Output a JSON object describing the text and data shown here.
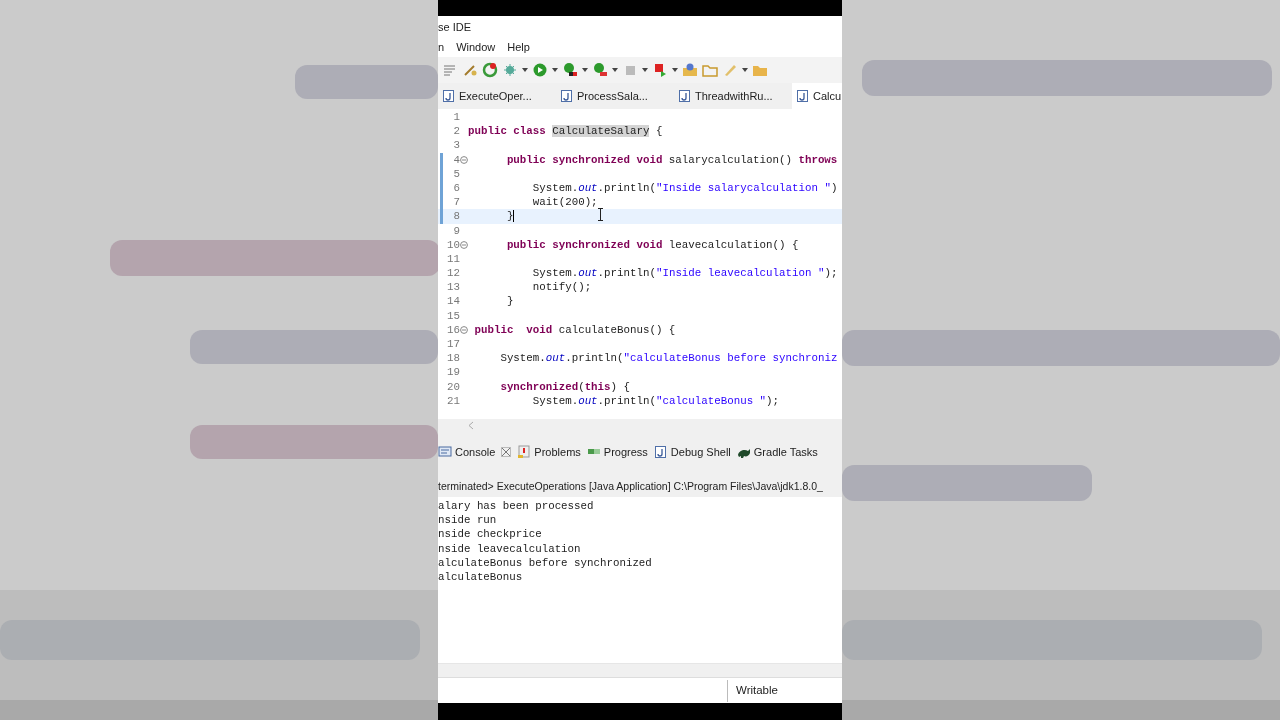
{
  "window": {
    "title": "se IDE"
  },
  "menu": [
    "n",
    "Window",
    "Help"
  ],
  "editor_tabs": [
    {
      "label": "ExecuteOper...",
      "selected": false
    },
    {
      "label": "ProcessSala...",
      "selected": false
    },
    {
      "label": "ThreadwithRu...",
      "selected": false
    },
    {
      "label": "Calcu",
      "selected": true
    }
  ],
  "code_lines": [
    {
      "number": "1",
      "fold": false,
      "current": false,
      "changed": false
    },
    {
      "number": "2",
      "fold": false,
      "current": false,
      "changed": false,
      "tokens": [
        {
          "kind": "keyword",
          "text": "public class "
        },
        {
          "kind": "highlight",
          "text": "CalculateSalary"
        },
        {
          "kind": "plain",
          "text": " {"
        }
      ]
    },
    {
      "number": "3",
      "fold": false,
      "current": false,
      "changed": false
    },
    {
      "number": "4",
      "fold": true,
      "current": false,
      "changed": true,
      "tokens": [
        {
          "kind": "keyword",
          "text": "      public synchronized void "
        },
        {
          "kind": "plain",
          "text": "salarycalculation() "
        },
        {
          "kind": "keyword",
          "text": "throws"
        }
      ]
    },
    {
      "number": "5",
      "fold": false,
      "current": false,
      "changed": true
    },
    {
      "number": "6",
      "fold": false,
      "current": false,
      "changed": true,
      "tokens": [
        {
          "kind": "plain",
          "text": "          System."
        },
        {
          "kind": "field",
          "text": "out"
        },
        {
          "kind": "plain",
          "text": ".println("
        },
        {
          "kind": "string",
          "text": "\"Inside salarycalculation \""
        },
        {
          "kind": "plain",
          "text": ")"
        }
      ]
    },
    {
      "number": "7",
      "fold": false,
      "current": false,
      "changed": true,
      "tokens": [
        {
          "kind": "plain",
          "text": "          wait(200);"
        }
      ]
    },
    {
      "number": "8",
      "fold": false,
      "current": true,
      "changed": true,
      "tokens": [
        {
          "kind": "plain",
          "text": "      }"
        }
      ]
    },
    {
      "number": "9",
      "fold": false,
      "current": false,
      "changed": false
    },
    {
      "number": "10",
      "fold": true,
      "current": false,
      "changed": false,
      "tokens": [
        {
          "kind": "keyword",
          "text": "      public synchronized void "
        },
        {
          "kind": "plain",
          "text": "leavecalculation() {"
        }
      ]
    },
    {
      "number": "11",
      "fold": false,
      "current": false,
      "changed": false
    },
    {
      "number": "12",
      "fold": false,
      "current": false,
      "changed": false,
      "tokens": [
        {
          "kind": "plain",
          "text": "          System."
        },
        {
          "kind": "field",
          "text": "out"
        },
        {
          "kind": "plain",
          "text": ".println("
        },
        {
          "kind": "string",
          "text": "\"Inside leavecalculation \""
        },
        {
          "kind": "plain",
          "text": ");"
        }
      ]
    },
    {
      "number": "13",
      "fold": false,
      "current": false,
      "changed": false,
      "tokens": [
        {
          "kind": "plain",
          "text": "          notify();"
        }
      ]
    },
    {
      "number": "14",
      "fold": false,
      "current": false,
      "changed": false,
      "tokens": [
        {
          "kind": "plain",
          "text": "      }"
        }
      ]
    },
    {
      "number": "15",
      "fold": false,
      "current": false,
      "changed": false
    },
    {
      "number": "16",
      "fold": true,
      "current": false,
      "changed": false,
      "tokens": [
        {
          "kind": "keyword",
          "text": " public  void "
        },
        {
          "kind": "plain",
          "text": "calculateBonus() {"
        }
      ]
    },
    {
      "number": "17",
      "fold": false,
      "current": false,
      "changed": false
    },
    {
      "number": "18",
      "fold": false,
      "current": false,
      "changed": false,
      "tokens": [
        {
          "kind": "plain",
          "text": "     System."
        },
        {
          "kind": "field",
          "text": "out"
        },
        {
          "kind": "plain",
          "text": ".println("
        },
        {
          "kind": "string",
          "text": "\"calculateBonus before synchroniz"
        }
      ]
    },
    {
      "number": "19",
      "fold": false,
      "current": false,
      "changed": false
    },
    {
      "number": "20",
      "fold": false,
      "current": false,
      "changed": false,
      "tokens": [
        {
          "kind": "keyword",
          "text": "     synchronized"
        },
        {
          "kind": "plain",
          "text": "("
        },
        {
          "kind": "keyword",
          "text": "this"
        },
        {
          "kind": "plain",
          "text": ") {"
        }
      ]
    },
    {
      "number": "21",
      "fold": false,
      "current": false,
      "changed": false,
      "tokens": [
        {
          "kind": "plain",
          "text": "          System."
        },
        {
          "kind": "field",
          "text": "out"
        },
        {
          "kind": "plain",
          "text": ".println("
        },
        {
          "kind": "string",
          "text": "\"calculateBonus \""
        },
        {
          "kind": "plain",
          "text": ");"
        }
      ]
    }
  ],
  "console_tabs": [
    {
      "label": "Console",
      "kind": "console",
      "closable": true
    },
    {
      "label": "Problems",
      "kind": "problems",
      "closable": false
    },
    {
      "label": "Progress",
      "kind": "progress",
      "closable": false
    },
    {
      "label": "Debug Shell",
      "kind": "debug",
      "closable": false
    },
    {
      "label": "Gradle Tasks",
      "kind": "gradle",
      "closable": false
    }
  ],
  "console": {
    "header": "terminated> ExecuteOperations [Java Application] C:\\Program Files\\Java\\jdk1.8.0_",
    "lines": [
      "alary has been processed",
      "nside run",
      "nside checkprice",
      "nside leavecalculation",
      "alculateBonus before synchronized",
      "alculateBonus"
    ]
  },
  "status_bar": {
    "mode": "Writable"
  }
}
